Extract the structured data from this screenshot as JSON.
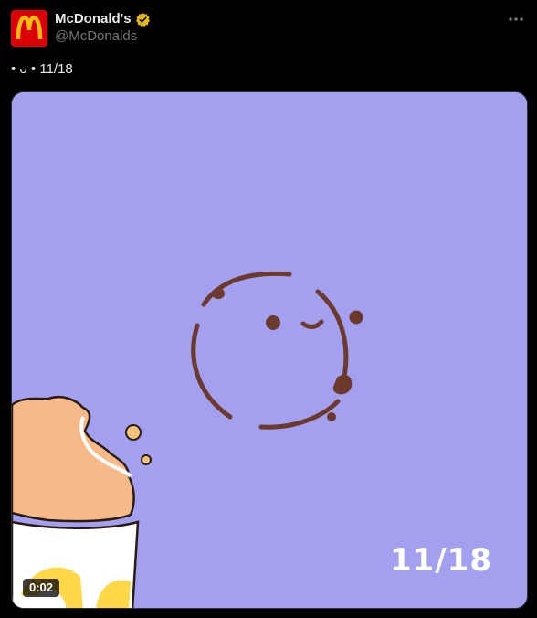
{
  "author": {
    "display_name": "McDonald's",
    "handle": "@McDonalds",
    "verified": true,
    "avatar_color": "#db0007",
    "logo_color": "#ffbc0d"
  },
  "post": {
    "text": "• ᴗ • 11/18"
  },
  "media": {
    "type": "video",
    "background_color": "#a2a0ef",
    "overlay_text": "11/18",
    "timestamp": "0:02"
  },
  "icons": {
    "more": "more-horizontal-icon",
    "verified": "verified-badge-icon"
  }
}
